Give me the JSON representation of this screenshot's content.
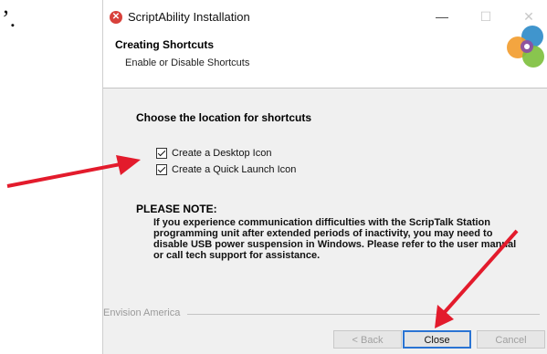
{
  "stray_mark": "’.",
  "window": {
    "title": "ScriptAbility Installation",
    "app_icon_glyph": "✕",
    "minimize_glyph": "—",
    "maximize_glyph": "☐",
    "close_glyph": "✕"
  },
  "header": {
    "title": "Creating Shortcuts",
    "subtitle": "Enable or Disable Shortcuts"
  },
  "body": {
    "choose_label": "Choose the location for shortcuts",
    "checkboxes": [
      {
        "label": "Create a Desktop Icon",
        "checked": true
      },
      {
        "label": "Create a Quick Launch Icon",
        "checked": true
      }
    ],
    "note_title": "PLEASE NOTE:",
    "note_text": "If you experience communication difficulties with the ScripTalk Station programming unit after extended periods of inactivity, you may need to disable USB power suspension in Windows. Please refer to the user manual or call tech support for assistance."
  },
  "footer": {
    "brand": "Envision America",
    "back_label": "< Back",
    "close_label": "Close",
    "cancel_label": "Cancel"
  },
  "colors": {
    "arrow": "#e31b2c",
    "focus_border": "#2a74d3",
    "panel_bg": "#f0f0f0"
  }
}
